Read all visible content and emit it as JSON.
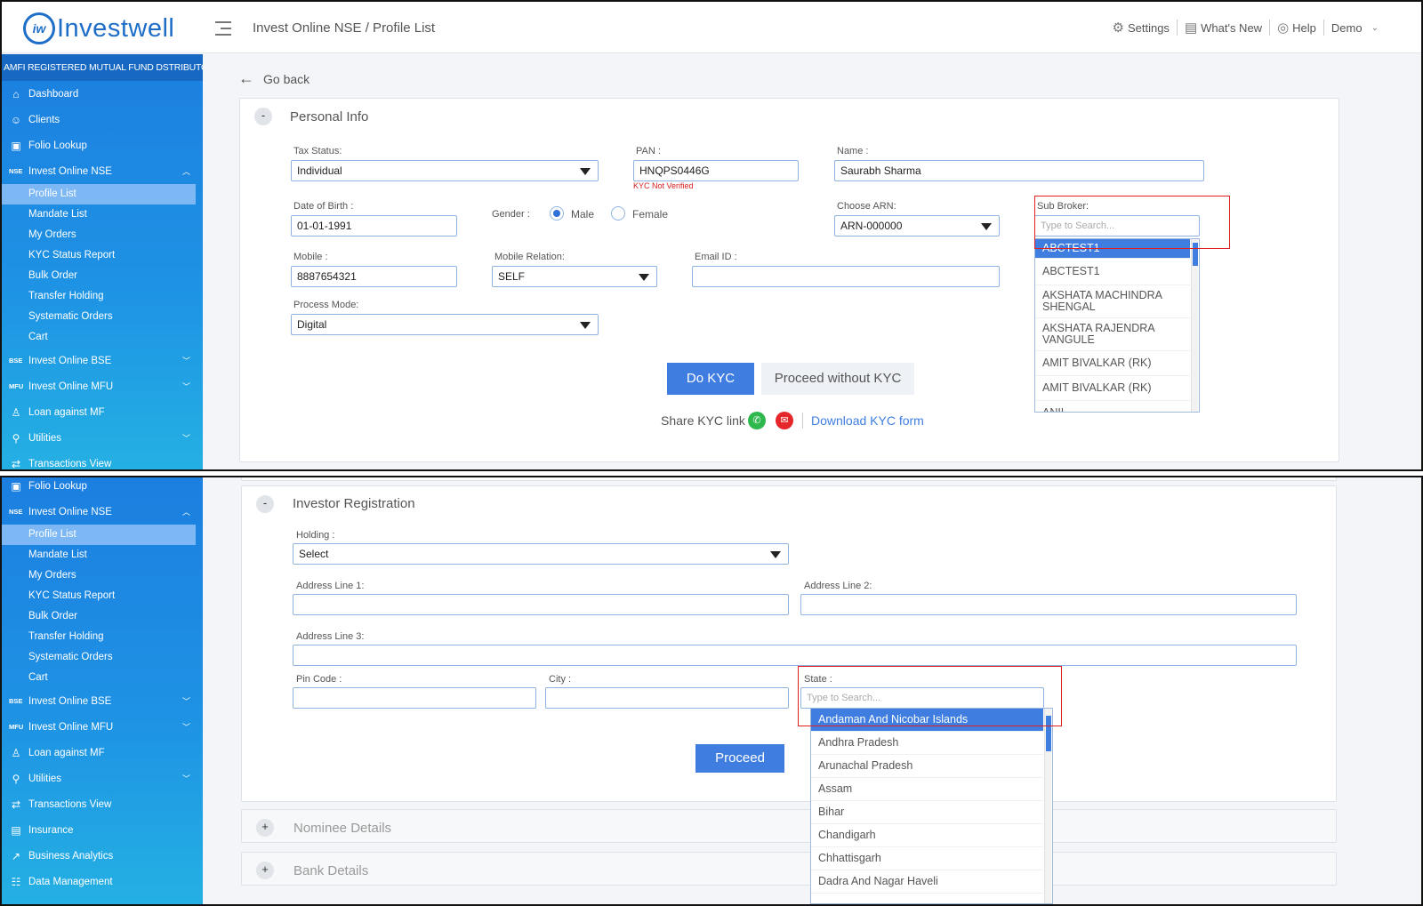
{
  "app": {
    "logo_mark": "iw",
    "logo_text": "Investwell",
    "breadcrumb": "Invest Online NSE / Profile List"
  },
  "topnav": {
    "settings": "Settings",
    "whats_new": "What's New",
    "help": "Help",
    "user": "Demo"
  },
  "sidebar": {
    "header": "AMFI REGISTERED MUTUAL FUND DSTRIBUTOR",
    "dashboard": "Dashboard",
    "clients": "Clients",
    "folio": "Folio Lookup",
    "nse_tag": "NSE",
    "nse": "Invest Online NSE",
    "sub": [
      "Profile List",
      "Mandate List",
      "My Orders",
      "KYC Status Report",
      "Bulk Order",
      "Transfer Holding",
      "Systematic Orders",
      "Cart"
    ],
    "bse_tag": "BSE",
    "bse": "Invest Online BSE",
    "mfu_tag": "MFU",
    "mfu": "Invest Online MFU",
    "loan": "Loan against MF",
    "utilities": "Utilities",
    "transactions": "Transactions View",
    "insurance": "Insurance",
    "analytics": "Business Analytics",
    "data_mgmt": "Data Management"
  },
  "goback": "Go back",
  "personal": {
    "toggle": "-",
    "title": "Personal Info",
    "tax_label": "Tax Status:",
    "tax_value": "Individual",
    "pan_label": "PAN :",
    "pan_value": "HNQPS0446G",
    "kyc_error": "KYC Not Verified",
    "name_label": "Name :",
    "name_value": "Saurabh Sharma",
    "dob_label": "Date of Birth :",
    "dob_value": "01-01-1991",
    "gender_label": "Gender :",
    "male": "Male",
    "female": "Female",
    "arn_label": "Choose ARN:",
    "arn_value": "ARN-000000",
    "sub_broker_label": "Sub Broker:",
    "sub_broker_placeholder": "Type to Search...",
    "sub_broker_options": [
      "ABCTEST1",
      "ABCTEST1",
      "AKSHATA MACHINDRA SHENGAL",
      "AKSHATA RAJENDRA VANGULE",
      "AMIT BIVALKAR (RK)",
      "AMIT BIVALKAR (RK)",
      "ANIL"
    ],
    "mobile_label": "Mobile :",
    "mobile_value": "8887654321",
    "relation_label": "Mobile Relation:",
    "relation_value": "SELF",
    "email_label": "Email ID :",
    "email_value": "",
    "process_label": "Process Mode:",
    "process_value": "Digital",
    "do_kyc": "Do KYC",
    "proceed_without": "Proceed without KYC",
    "share_label": "Share KYC link :",
    "download": "Download KYC form"
  },
  "registration": {
    "toggle": "-",
    "title": "Investor Registration",
    "holding_label": "Holding :",
    "holding_value": "Select",
    "addr1_label": "Address Line 1:",
    "addr2_label": "Address Line 2:",
    "addr3_label": "Address Line 3:",
    "pin_label": "Pin Code :",
    "city_label": "City :",
    "state_label": "State :",
    "state_placeholder": "Type to Search...",
    "state_options": [
      "Andaman And Nicobar Islands",
      "Andhra Pradesh",
      "Arunachal Pradesh",
      "Assam",
      "Bihar",
      "Chandigarh",
      "Chhattisgarh",
      "Dadra And Nagar Haveli"
    ],
    "proceed": "Proceed"
  },
  "nominee": {
    "toggle": "+",
    "title": "Nominee Details"
  },
  "bank": {
    "toggle": "+",
    "title": "Bank Details"
  },
  "colors": {
    "accent": "#3f7ee0",
    "sidebar": "#1c7fe0",
    "error": "#d62020",
    "highlight": "#e02020"
  }
}
